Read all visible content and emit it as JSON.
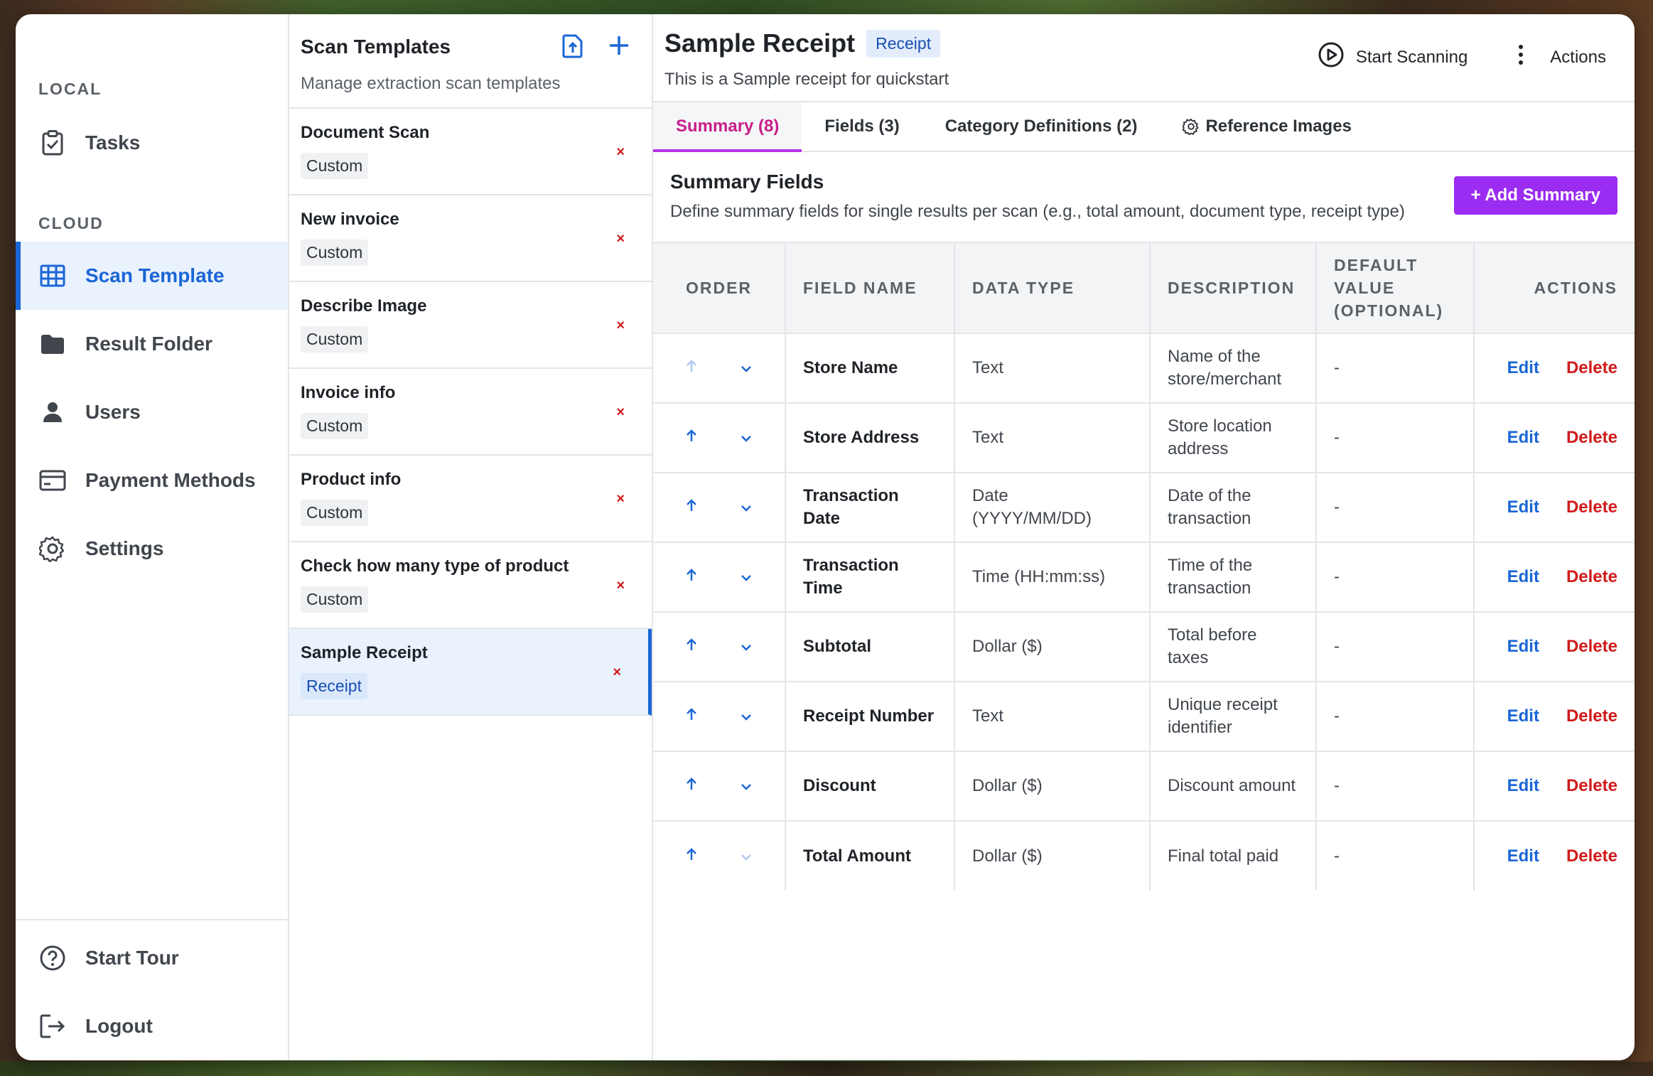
{
  "sidebar": {
    "local_label": "LOCAL",
    "cloud_label": "CLOUD",
    "items": [
      {
        "label": "Tasks",
        "icon": "clipboard-check-icon"
      },
      {
        "label": "Scan Template",
        "icon": "table-grid-icon"
      },
      {
        "label": "Result Folder",
        "icon": "folder-icon"
      },
      {
        "label": "Users",
        "icon": "user-icon"
      },
      {
        "label": "Payment Methods",
        "icon": "credit-card-icon"
      },
      {
        "label": "Settings",
        "icon": "gear-icon"
      }
    ],
    "bottom": [
      {
        "label": "Start Tour",
        "icon": "help-circle-icon"
      },
      {
        "label": "Logout",
        "icon": "logout-icon"
      }
    ]
  },
  "templates": {
    "title": "Scan Templates",
    "subtitle": "Manage extraction scan templates",
    "items": [
      {
        "name": "Document Scan",
        "type": "Custom"
      },
      {
        "name": "New invoice",
        "type": "Custom"
      },
      {
        "name": "Describe Image",
        "type": "Custom"
      },
      {
        "name": "Invoice info",
        "type": "Custom"
      },
      {
        "name": "Product info",
        "type": "Custom"
      },
      {
        "name": "Check how many type of product",
        "type": "Custom"
      },
      {
        "name": "Sample Receipt",
        "type": "Receipt"
      }
    ],
    "delete_glyph": "×"
  },
  "main": {
    "title": "Sample Receipt",
    "type_badge": "Receipt",
    "description": "This is a Sample receipt for quickstart",
    "start_scanning": "Start Scanning",
    "actions": "Actions",
    "tabs": [
      {
        "label": "Summary (8)"
      },
      {
        "label": "Fields (3)"
      },
      {
        "label": "Category Definitions (2)"
      },
      {
        "label": "Reference Images"
      }
    ],
    "summary_title": "Summary Fields",
    "summary_subtitle": "Define summary fields for single results per scan (e.g., total amount, document type, receipt type)",
    "add_button": "+ Add Summary",
    "columns": {
      "order": "ORDER",
      "field_name": "FIELD NAME",
      "data_type": "DATA TYPE",
      "description": "DESCRIPTION",
      "default_value": "DEFAULT VALUE (OPTIONAL)",
      "actions": "ACTIONS"
    },
    "edit_label": "Edit",
    "delete_label": "Delete",
    "rows": [
      {
        "name": "Store Name",
        "type": "Text",
        "description": "Name of the store/merchant",
        "default": "-"
      },
      {
        "name": "Store Address",
        "type": "Text",
        "description": "Store location address",
        "default": "-"
      },
      {
        "name": "Transaction Date",
        "type": "Date (YYYY/MM/DD)",
        "description": "Date of the transaction",
        "default": "-"
      },
      {
        "name": "Transaction Time",
        "type": "Time (HH:mm:ss)",
        "description": "Time of the transaction",
        "default": "-"
      },
      {
        "name": "Subtotal",
        "type": "Dollar ($)",
        "description": "Total before taxes",
        "default": "-"
      },
      {
        "name": "Receipt Number",
        "type": "Text",
        "description": "Unique receipt identifier",
        "default": "-"
      },
      {
        "name": "Discount",
        "type": "Dollar ($)",
        "description": "Discount amount",
        "default": "-"
      },
      {
        "name": "Total Amount",
        "type": "Dollar ($)",
        "description": "Final total paid",
        "default": "-"
      }
    ]
  },
  "colors": {
    "accent_blue": "#1a66d6",
    "accent_purple": "#9b2cf2",
    "active_tab_text": "#c81e8a",
    "delete_red": "#d11a1a"
  }
}
